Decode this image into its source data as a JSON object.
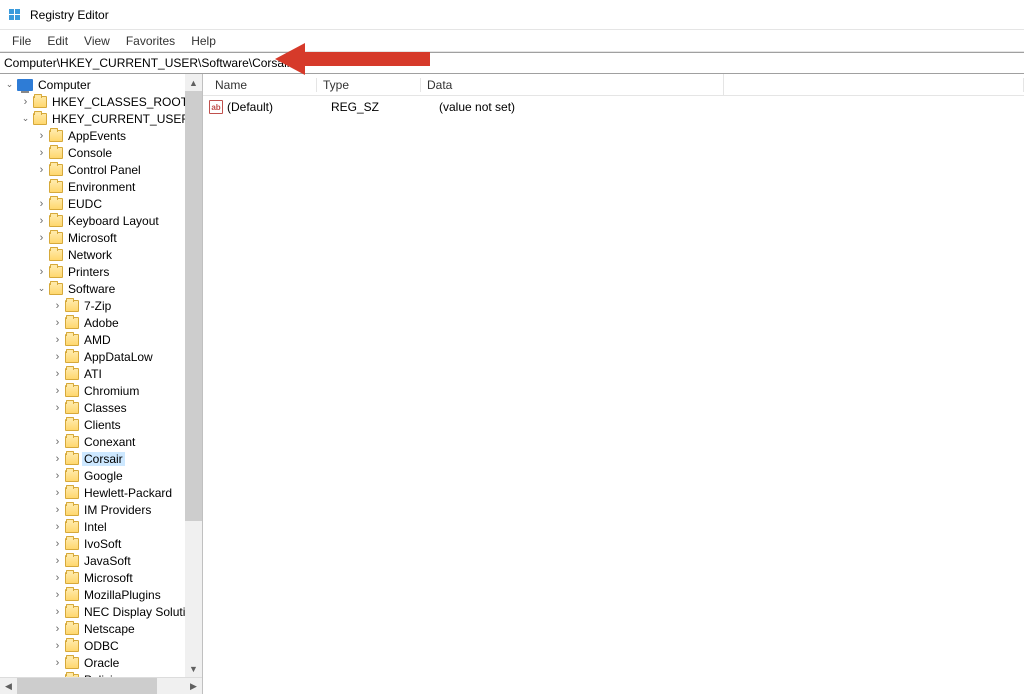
{
  "window": {
    "title": "Registry Editor"
  },
  "menu": {
    "file": "File",
    "edit": "Edit",
    "view": "View",
    "favorites": "Favorites",
    "help": "Help"
  },
  "address": {
    "path": "Computer\\HKEY_CURRENT_USER\\Software\\Corsair"
  },
  "tree": {
    "root": "Computer",
    "nodes": [
      {
        "label": "HKEY_CLASSES_ROOT",
        "depth": 1,
        "exp": ">",
        "icon": "folder"
      },
      {
        "label": "HKEY_CURRENT_USER",
        "depth": 1,
        "exp": "v",
        "icon": "folder"
      },
      {
        "label": "AppEvents",
        "depth": 2,
        "exp": ">",
        "icon": "folder"
      },
      {
        "label": "Console",
        "depth": 2,
        "exp": ">",
        "icon": "folder"
      },
      {
        "label": "Control Panel",
        "depth": 2,
        "exp": ">",
        "icon": "folder"
      },
      {
        "label": "Environment",
        "depth": 2,
        "exp": "",
        "icon": "folder"
      },
      {
        "label": "EUDC",
        "depth": 2,
        "exp": ">",
        "icon": "folder"
      },
      {
        "label": "Keyboard Layout",
        "depth": 2,
        "exp": ">",
        "icon": "folder"
      },
      {
        "label": "Microsoft",
        "depth": 2,
        "exp": ">",
        "icon": "folder"
      },
      {
        "label": "Network",
        "depth": 2,
        "exp": "",
        "icon": "folder"
      },
      {
        "label": "Printers",
        "depth": 2,
        "exp": ">",
        "icon": "folder"
      },
      {
        "label": "Software",
        "depth": 2,
        "exp": "v",
        "icon": "folder"
      },
      {
        "label": "7-Zip",
        "depth": 3,
        "exp": ">",
        "icon": "folder"
      },
      {
        "label": "Adobe",
        "depth": 3,
        "exp": ">",
        "icon": "folder"
      },
      {
        "label": "AMD",
        "depth": 3,
        "exp": ">",
        "icon": "folder"
      },
      {
        "label": "AppDataLow",
        "depth": 3,
        "exp": ">",
        "icon": "folder"
      },
      {
        "label": "ATI",
        "depth": 3,
        "exp": ">",
        "icon": "folder"
      },
      {
        "label": "Chromium",
        "depth": 3,
        "exp": ">",
        "icon": "folder"
      },
      {
        "label": "Classes",
        "depth": 3,
        "exp": ">",
        "icon": "folder"
      },
      {
        "label": "Clients",
        "depth": 3,
        "exp": "",
        "icon": "folder"
      },
      {
        "label": "Conexant",
        "depth": 3,
        "exp": ">",
        "icon": "folder"
      },
      {
        "label": "Corsair",
        "depth": 3,
        "exp": ">",
        "icon": "folder",
        "selected": true
      },
      {
        "label": "Google",
        "depth": 3,
        "exp": ">",
        "icon": "folder"
      },
      {
        "label": "Hewlett-Packard",
        "depth": 3,
        "exp": ">",
        "icon": "folder"
      },
      {
        "label": "IM Providers",
        "depth": 3,
        "exp": ">",
        "icon": "folder"
      },
      {
        "label": "Intel",
        "depth": 3,
        "exp": ">",
        "icon": "folder"
      },
      {
        "label": "IvoSoft",
        "depth": 3,
        "exp": ">",
        "icon": "folder"
      },
      {
        "label": "JavaSoft",
        "depth": 3,
        "exp": ">",
        "icon": "folder"
      },
      {
        "label": "Microsoft",
        "depth": 3,
        "exp": ">",
        "icon": "folder"
      },
      {
        "label": "MozillaPlugins",
        "depth": 3,
        "exp": ">",
        "icon": "folder"
      },
      {
        "label": "NEC Display Solution",
        "depth": 3,
        "exp": ">",
        "icon": "folder"
      },
      {
        "label": "Netscape",
        "depth": 3,
        "exp": ">",
        "icon": "folder"
      },
      {
        "label": "ODBC",
        "depth": 3,
        "exp": ">",
        "icon": "folder"
      },
      {
        "label": "Oracle",
        "depth": 3,
        "exp": ">",
        "icon": "folder"
      },
      {
        "label": "Policies",
        "depth": 3,
        "exp": ">",
        "icon": "folder"
      }
    ]
  },
  "list": {
    "columns": {
      "name": "Name",
      "type": "Type",
      "data": "Data"
    },
    "rows": [
      {
        "name": "(Default)",
        "type": "REG_SZ",
        "data": "(value not set)"
      }
    ]
  }
}
